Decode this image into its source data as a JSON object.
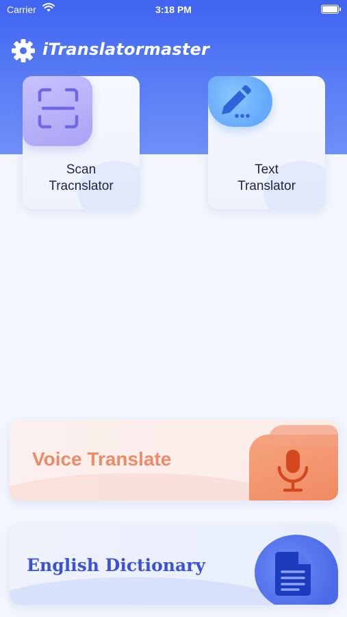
{
  "status_bar": {
    "carrier": "Carrier",
    "time": "3:18 PM"
  },
  "header": {
    "title": "iTranslatormaster",
    "settings_icon": "gear-icon"
  },
  "tiles": [
    {
      "line1": "Scan",
      "line2": "Tracnslator",
      "icon": "scan-frame-icon"
    },
    {
      "line1": "Text",
      "line2": "Translator",
      "icon": "pencil-icon"
    }
  ],
  "banners": {
    "voice": {
      "label": "Voice Translate",
      "icon": "microphone-icon"
    },
    "dictionary": {
      "label": "English Dictionary",
      "icon": "document-icon"
    }
  },
  "colors": {
    "header_blue": "#4a6cf4",
    "voice_orange": "#ee8a66",
    "dictionary_blue": "#3a52d6"
  }
}
